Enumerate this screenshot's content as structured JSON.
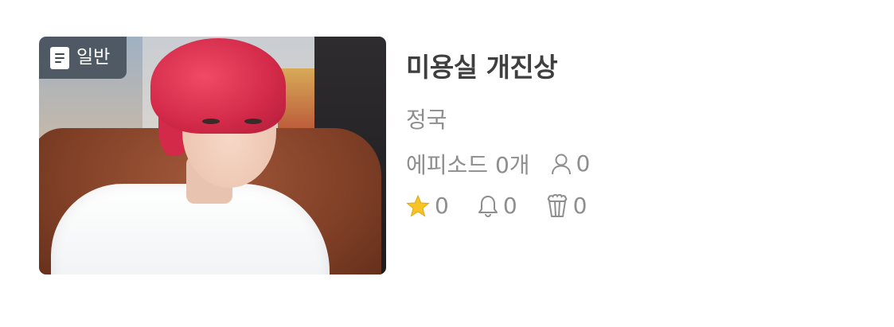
{
  "card": {
    "badge": {
      "label": "일반",
      "icon": "document-icon"
    },
    "thumbnail": {
      "description_icon": "cover-image"
    },
    "title": "미용실 개진상",
    "author": "정국",
    "episodes_label": "에피소드 0개",
    "subscribers": {
      "icon": "person-icon",
      "value": "0"
    },
    "stars": {
      "icon": "star-icon",
      "value": "0",
      "color": "#f7c325"
    },
    "alerts": {
      "icon": "bell-icon",
      "value": "0"
    },
    "popcorn": {
      "icon": "popcorn-icon",
      "value": "0"
    }
  },
  "colors": {
    "title": "#3f3f3f",
    "meta": "#8e8e8e",
    "badge_bg": "#3c4650"
  }
}
